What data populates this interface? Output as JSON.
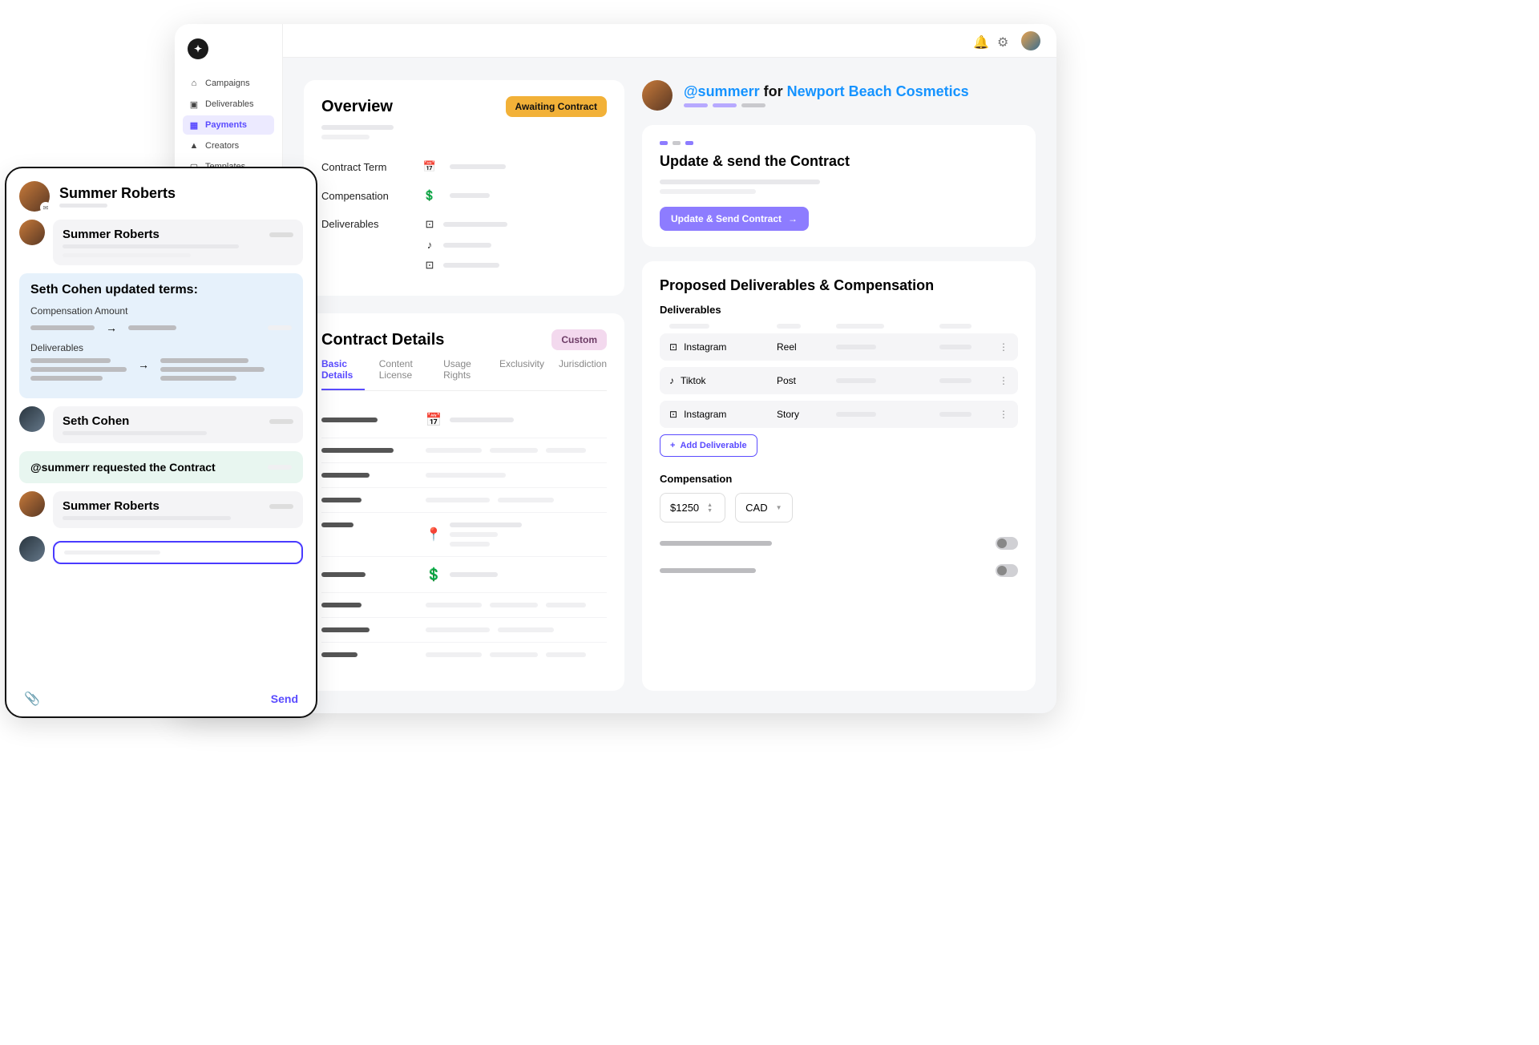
{
  "sidebar": {
    "items": [
      {
        "label": "Campaigns",
        "icon": "home"
      },
      {
        "label": "Deliverables",
        "icon": "box"
      },
      {
        "label": "Payments",
        "icon": "card",
        "active": true
      },
      {
        "label": "Creators",
        "icon": "user"
      },
      {
        "label": "Templates",
        "icon": "file"
      }
    ]
  },
  "overview": {
    "title": "Overview",
    "status_badge": "Awaiting Contract",
    "rows": {
      "contract_term": "Contract Term",
      "compensation": "Compensation",
      "deliverables": "Deliverables"
    }
  },
  "details": {
    "title": "Contract Details",
    "badge": "Custom",
    "tabs": [
      "Basic Details",
      "Content License",
      "Usage Rights",
      "Exclusivity",
      "Jurisdiction"
    ]
  },
  "creator": {
    "handle": "@summerr",
    "joiner": " for ",
    "brand": "Newport Beach Cosmetics"
  },
  "update_card": {
    "title": "Update & send the Contract",
    "button": "Update & Send Contract"
  },
  "proposed": {
    "title": "Proposed Deliverables & Compensation",
    "deliverables_label": "Deliverables",
    "rows": [
      {
        "platform": "Instagram",
        "type": "Reel",
        "icon": "instagram"
      },
      {
        "platform": "Tiktok",
        "type": "Post",
        "icon": "tiktok"
      },
      {
        "platform": "Instagram",
        "type": "Story",
        "icon": "instagram"
      }
    ],
    "add_btn": "Add Deliverable",
    "compensation_label": "Compensation",
    "amount": "$1250",
    "currency": "CAD"
  },
  "chat": {
    "header_name": "Summer Roberts",
    "msg1_name": "Summer Roberts",
    "sys1_title": "Seth Cohen updated terms:",
    "sys1_row1": "Compensation Amount",
    "sys1_row2": "Deliverables",
    "msg2_name": "Seth Cohen",
    "sys2_text": "@summerr requested the Contract",
    "msg3_name": "Summer Roberts",
    "send": "Send"
  }
}
